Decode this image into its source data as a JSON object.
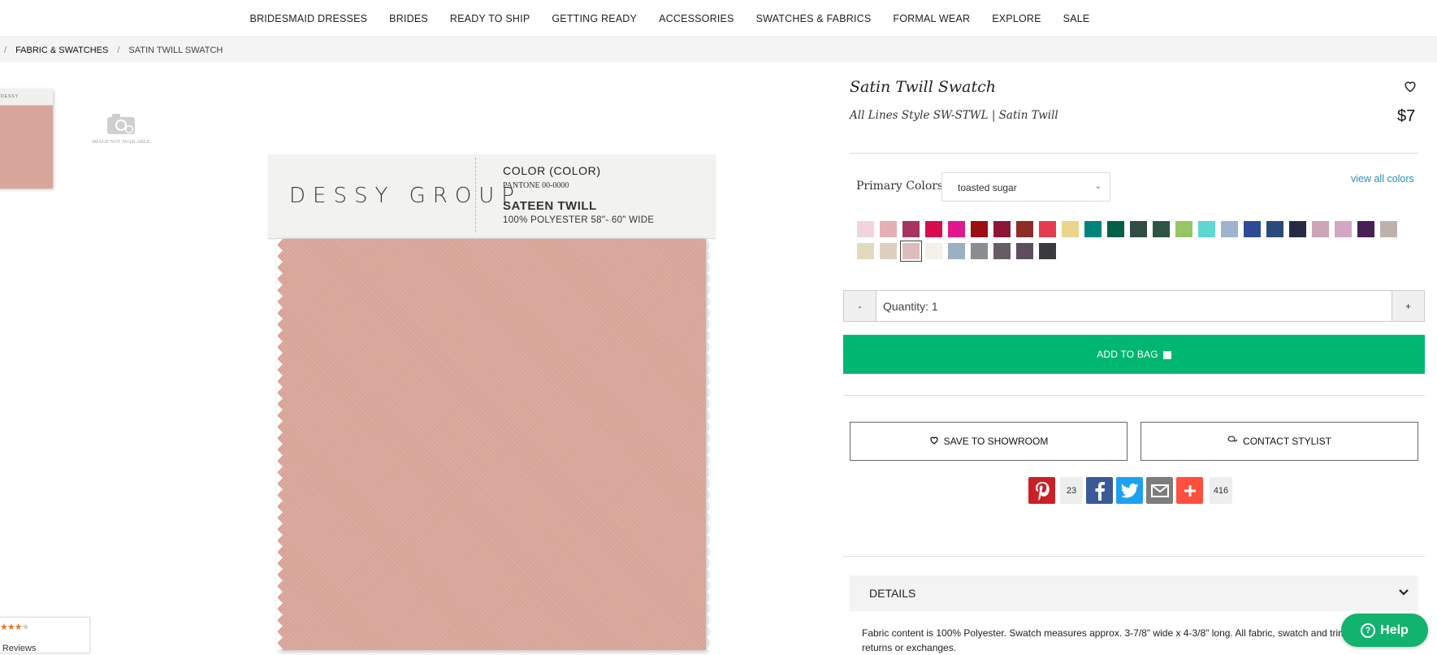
{
  "nav": {
    "items": [
      "BRIDESMAID DRESSES",
      "BRIDES",
      "READY TO SHIP",
      "GETTING READY",
      "ACCESSORIES",
      "SWATCHES & FABRICS",
      "FORMAL WEAR",
      "EXPLORE",
      "SALE"
    ]
  },
  "breadcrumb": {
    "sep": "/",
    "link": "FABRIC & SWATCHES",
    "current": "SATIN TWILL SWATCH"
  },
  "gallery": {
    "thumb2_text": "IMAGE NOT AVAILABLE",
    "label": {
      "brand": "DESSY GROUP",
      "color": "COLOR (COLOR)",
      "pantone": "PANTONE 00-0000",
      "fabric": "SATEEN TWILL",
      "content": "100% POLYESTER  58\"- 60\" WIDE"
    }
  },
  "reviews": {
    "text": "er Reviews",
    "stars": "★★★",
    "stars_off": "★"
  },
  "product": {
    "title": "Satin Twill Swatch",
    "subtitle": "All Lines Style SW-STWL  |  Satin Twill",
    "price": "$7"
  },
  "colors": {
    "label": "Primary Colors:",
    "selected": "toasted sugar",
    "view_all": "view all colors",
    "swatches": [
      "#f4d4dc",
      "#e3b1b5",
      "#a63563",
      "#d70c4e",
      "#e01890",
      "#9c0e13",
      "#8e1538",
      "#8d2d25",
      "#e63a51",
      "#ead58a",
      "#00857e",
      "#035f47",
      "#2f4c45",
      "#2d5543",
      "#97c563",
      "#5ed7d2",
      "#9fb3ce",
      "#2e4c95",
      "#2a4a7c",
      "#262a43",
      "#cca6b4",
      "#d5a6c3",
      "#471e56",
      "#bfb0ae",
      "#e3dabc",
      "#ddd0c0",
      "#dcbdbd",
      "#f5f1ea",
      "#9cafc3",
      "#8a8e93",
      "#675c63",
      "#5d4d5f",
      "#3a3a3f"
    ],
    "selected_index": 26
  },
  "quantity": {
    "minus": "-",
    "plus": "+",
    "value": "Quantity: 1"
  },
  "add_to_bag": "ADD TO BAG",
  "save_showroom": "SAVE TO SHOWROOM",
  "contact_stylist": "CONTACT STYLIST",
  "share": {
    "pinterest_count": "23",
    "total_count": "416"
  },
  "details": {
    "heading": "DETAILS",
    "text": "Fabric content is 100% Polyester. Swatch measures approx. 3-7/8\" wide x 4-3/8\" long. All fabric, swatch and trim final. No returns or exchanges."
  },
  "help": {
    "label": "Help"
  }
}
